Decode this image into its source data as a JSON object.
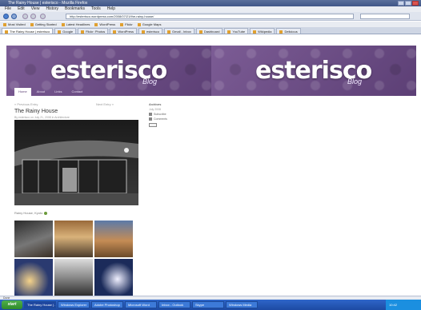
{
  "browser": {
    "window_title": "The Rainy House | esterisco - Mozilla Firefox",
    "menu": [
      "File",
      "Edit",
      "View",
      "History",
      "Bookmarks",
      "Tools",
      "Help"
    ],
    "url": "http://esterisco.wordpress.com/2008/07/21/the-rainy-house/",
    "bookmarks": [
      "Most Visited",
      "Getting Started",
      "Latest Headlines",
      "WordPress",
      "Flickr",
      "Google Maps"
    ],
    "tabs": [
      {
        "label": "The Rainy House | esterisco",
        "active": true
      },
      {
        "label": "Google",
        "active": false
      },
      {
        "label": "Flickr: Photos",
        "active": false
      },
      {
        "label": "WordPress",
        "active": false
      },
      {
        "label": "esterisco",
        "active": false
      },
      {
        "label": "Gmail - Inbox",
        "active": false
      },
      {
        "label": "Dashboard",
        "active": false
      },
      {
        "label": "YouTube",
        "active": false
      },
      {
        "label": "Wikipedia",
        "active": false
      },
      {
        "label": "Delicious",
        "active": false
      }
    ],
    "status": "Done"
  },
  "site": {
    "logo": "esterisco",
    "logo_sub": "Blog",
    "nav": [
      {
        "label": "Home",
        "active": true
      },
      {
        "label": "About",
        "active": false
      },
      {
        "label": "Links",
        "active": false
      },
      {
        "label": "Contact",
        "active": false
      }
    ]
  },
  "post": {
    "breadcrumb": "« Previous Entry",
    "pager": "Next Entry »",
    "title": "The Rainy House",
    "meta": "By esterisco on July 21, 2008 in Architecture",
    "caption": "Rainy House, Kyoto"
  },
  "sidebar": {
    "heading": "Archives",
    "sub": "July 2008",
    "rows": [
      "Subscribe",
      "Comments"
    ]
  },
  "taskbar": {
    "start": "start",
    "buttons": [
      "The Rainy House | ...",
      "Windows Explorer",
      "Adobe Photoshop",
      "Microsoft Word",
      "Inbox - Outlook",
      "Skype",
      "Windows Media"
    ],
    "clock": "10:42"
  },
  "colors": {
    "banner": "#6e4f88",
    "taskbar": "#1d4aa3"
  }
}
